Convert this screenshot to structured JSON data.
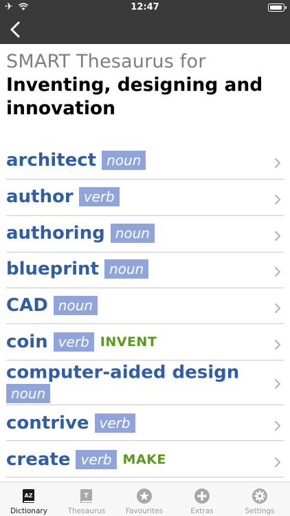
{
  "status_bar": {
    "time": "12:47"
  },
  "header": {
    "subtitle": "SMART Thesaurus for",
    "title": "Inventing, designing and innovation"
  },
  "entries": [
    {
      "word": "architect",
      "pos": "noun",
      "tag": ""
    },
    {
      "word": "author",
      "pos": "verb",
      "tag": ""
    },
    {
      "word": "authoring",
      "pos": "noun",
      "tag": ""
    },
    {
      "word": "blueprint",
      "pos": "noun",
      "tag": ""
    },
    {
      "word": "CAD",
      "pos": "noun",
      "tag": ""
    },
    {
      "word": "coin",
      "pos": "verb",
      "tag": "INVENT"
    },
    {
      "word": "computer-aided design",
      "pos": "noun",
      "tag": ""
    },
    {
      "word": "contrive",
      "pos": "verb",
      "tag": ""
    },
    {
      "word": "create",
      "pos": "verb",
      "tag": "MAKE"
    }
  ],
  "tabs": [
    {
      "label": "Dictionary",
      "icon": "dictionary-icon",
      "active": true
    },
    {
      "label": "Thesaurus",
      "icon": "thesaurus-icon",
      "active": false
    },
    {
      "label": "Favourites",
      "icon": "star-icon",
      "active": false
    },
    {
      "label": "Extras",
      "icon": "plus-icon",
      "active": false
    },
    {
      "label": "Settings",
      "icon": "gear-icon",
      "active": false
    }
  ],
  "colors": {
    "nav_bg": "#3a3a3a",
    "headword": "#2f5da8",
    "pos_bg": "#8fa4da",
    "tag": "#5a9a1a"
  }
}
